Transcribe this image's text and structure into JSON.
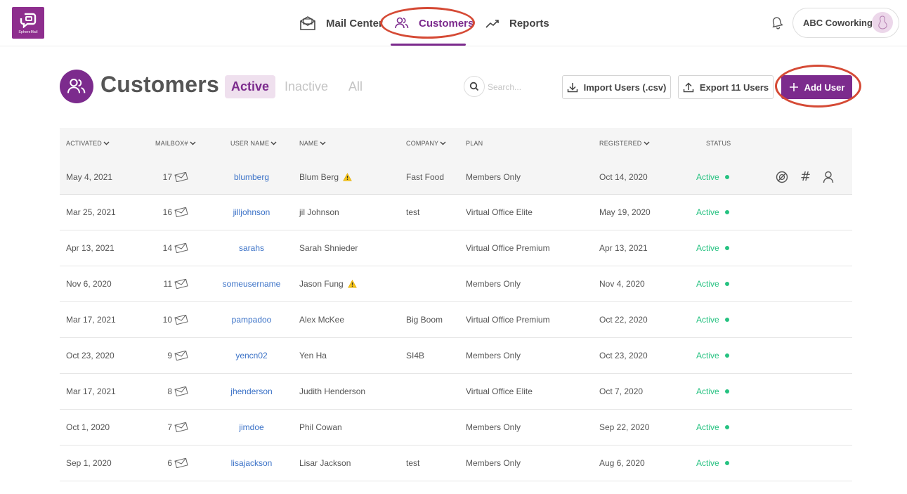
{
  "logo": {
    "text": "SphereMail"
  },
  "nav": [
    {
      "label": "Mail Center",
      "icon": "mail-icon"
    },
    {
      "label": "Customers",
      "icon": "users-icon",
      "active": true
    },
    {
      "label": "Reports",
      "icon": "chart-line-icon"
    }
  ],
  "account": {
    "name": "ABC Coworking"
  },
  "page": {
    "title": "Customers",
    "tabs": [
      {
        "label": "Active",
        "active": true
      },
      {
        "label": "Inactive"
      },
      {
        "label": "All"
      }
    ],
    "search_placeholder": "Search...",
    "import_label": "Import Users (.csv)",
    "export_label": "Export 11 Users",
    "add_label": "Add User"
  },
  "table": {
    "headers": {
      "activated": "ACTIVATED",
      "mailbox": "MAILBOX#",
      "username": "USER NAME",
      "name": "NAME",
      "company": "COMPANY",
      "plan": "PLAN",
      "registered": "REGISTERED",
      "status": "STATUS"
    },
    "rows": [
      {
        "activated": "May 4, 2021",
        "mailbox": "17",
        "username": "blumberg",
        "name": "Blum Berg",
        "warning": true,
        "company": "Fast Food",
        "plan": "Members Only",
        "registered": "Oct 14, 2020",
        "status": "Active"
      },
      {
        "activated": "Mar 25, 2021",
        "mailbox": "16",
        "username": "jilljohnson",
        "name": "jil Johnson",
        "warning": false,
        "company": "test",
        "plan": "Virtual Office Elite",
        "registered": "May 19, 2020",
        "status": "Active"
      },
      {
        "activated": "Apr 13, 2021",
        "mailbox": "14",
        "username": "sarahs",
        "name": "Sarah Shnieder",
        "warning": false,
        "company": "",
        "plan": "Virtual Office Premium",
        "registered": "Apr 13, 2021",
        "status": "Active"
      },
      {
        "activated": "Nov 6, 2020",
        "mailbox": "11",
        "username": "someusername",
        "name": "Jason Fung",
        "warning": true,
        "company": "",
        "plan": "Members Only",
        "registered": "Nov 4, 2020",
        "status": "Active"
      },
      {
        "activated": "Mar 17, 2021",
        "mailbox": "10",
        "username": "pampadoo",
        "name": "Alex McKee",
        "warning": false,
        "company": "Big Boom",
        "plan": "Virtual Office Premium",
        "registered": "Oct 22, 2020",
        "status": "Active"
      },
      {
        "activated": "Oct 23, 2020",
        "mailbox": "9",
        "username": "yencn02",
        "name": "Yen Ha",
        "warning": false,
        "company": "SI4B",
        "plan": "Members Only",
        "registered": "Oct 23, 2020",
        "status": "Active"
      },
      {
        "activated": "Mar 17, 2021",
        "mailbox": "8",
        "username": "jhenderson",
        "name": "Judith Henderson",
        "warning": false,
        "company": "",
        "plan": "Virtual Office Elite",
        "registered": "Oct 7, 2020",
        "status": "Active"
      },
      {
        "activated": "Oct 1, 2020",
        "mailbox": "7",
        "username": "jimdoe",
        "name": "Phil Cowan",
        "warning": false,
        "company": "",
        "plan": "Members Only",
        "registered": "Sep 22, 2020",
        "status": "Active"
      },
      {
        "activated": "Sep 1, 2020",
        "mailbox": "6",
        "username": "lisajackson",
        "name": "Lisar Jackson",
        "warning": false,
        "company": "test",
        "plan": "Members Only",
        "registered": "Aug 6, 2020",
        "status": "Active"
      }
    ]
  },
  "colors": {
    "brand": "#7c2b8d",
    "active_status": "#26c281",
    "link": "#3b72c7",
    "highlight": "#d54a35"
  }
}
